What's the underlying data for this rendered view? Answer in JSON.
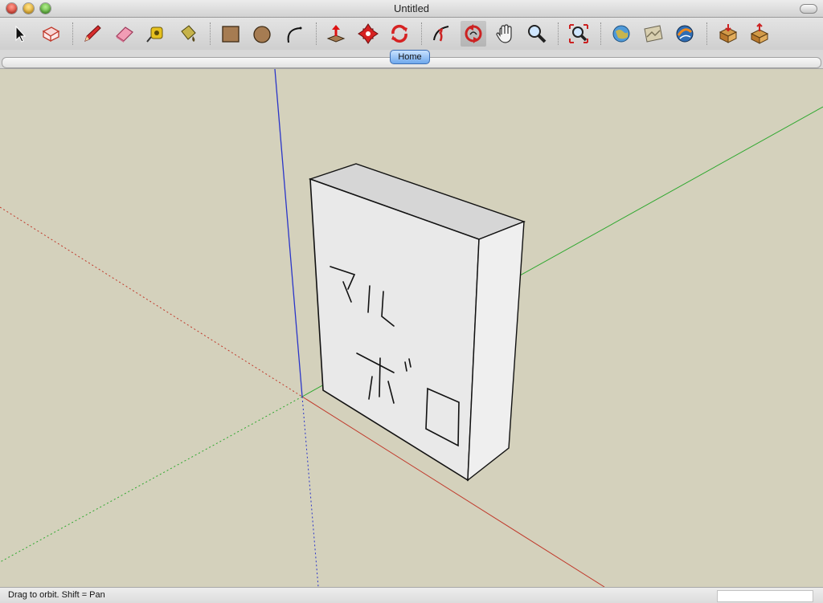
{
  "window": {
    "title": "Untitled"
  },
  "toolbar": {
    "tools": [
      {
        "name": "select-tool-icon"
      },
      {
        "name": "make-component-tool-icon"
      },
      {
        "name": "pencil-tool-icon"
      },
      {
        "name": "eraser-tool-icon"
      },
      {
        "name": "tape-measure-tool-icon"
      },
      {
        "name": "paint-bucket-tool-icon"
      },
      {
        "name": "rectangle-tool-icon"
      },
      {
        "name": "circle-tool-icon"
      },
      {
        "name": "arc-tool-icon"
      },
      {
        "name": "push-pull-tool-icon"
      },
      {
        "name": "move-tool-icon"
      },
      {
        "name": "rotate-tool-icon"
      },
      {
        "name": "follow-me-tool-icon"
      },
      {
        "name": "orbit-tool-icon",
        "active": true
      },
      {
        "name": "pan-tool-icon"
      },
      {
        "name": "zoom-tool-icon"
      },
      {
        "name": "zoom-extents-tool-icon"
      },
      {
        "name": "get-current-view-icon"
      },
      {
        "name": "toggle-terrain-icon"
      },
      {
        "name": "place-model-icon"
      },
      {
        "name": "get-models-icon"
      },
      {
        "name": "share-model-icon"
      }
    ]
  },
  "scenes": {
    "tabs": [
      {
        "label": "Home"
      }
    ]
  },
  "model": {
    "face_text": [
      "マル",
      "ポロ"
    ]
  },
  "status": {
    "text": "Drag to orbit.  Shift = Pan"
  },
  "colors": {
    "viewport_bg": "#d4d1bc",
    "axis_red": "#c0392b",
    "axis_green": "#2fa82f",
    "axis_blue": "#2a35c9",
    "box_front": "#e9e9e9",
    "box_top": "#d6d6d6",
    "box_side": "#efefef",
    "scene_tab": "#6fa8ec"
  }
}
